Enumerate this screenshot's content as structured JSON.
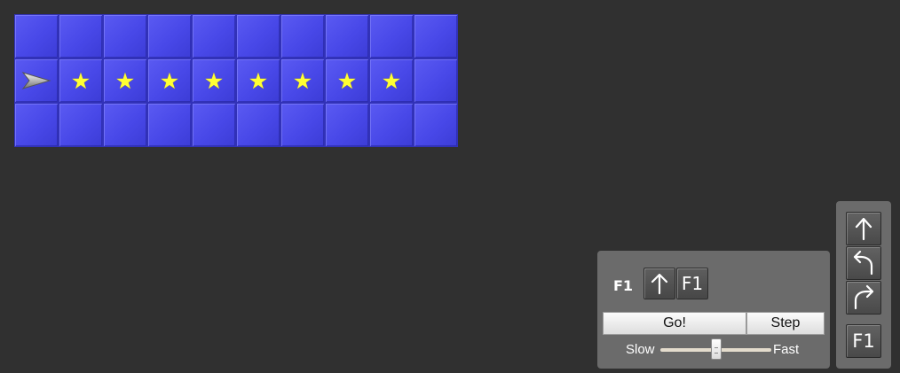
{
  "board": {
    "rows": 3,
    "cols": 10,
    "robot": {
      "row": 1,
      "col": 0,
      "facing": "right"
    },
    "stars": [
      {
        "row": 1,
        "col": 1
      },
      {
        "row": 1,
        "col": 2
      },
      {
        "row": 1,
        "col": 3
      },
      {
        "row": 1,
        "col": 4
      },
      {
        "row": 1,
        "col": 5
      },
      {
        "row": 1,
        "col": 6
      },
      {
        "row": 1,
        "col": 7
      },
      {
        "row": 1,
        "col": 8
      }
    ],
    "star_glyph": "★",
    "colors": {
      "tile": "#4848e8",
      "star": "#ffff33"
    }
  },
  "program": {
    "function_label": "F1",
    "slots": [
      {
        "type": "forward",
        "icon": "up-arrow-icon"
      },
      {
        "type": "call",
        "label": "F1"
      }
    ],
    "go_label": "Go!",
    "step_label": "Step",
    "speed": {
      "slow_label": "Slow",
      "fast_label": "Fast",
      "value": 0.5
    }
  },
  "palette": {
    "items": [
      {
        "type": "forward",
        "icon": "up-arrow-icon"
      },
      {
        "type": "turn-left",
        "icon": "turn-left-icon"
      },
      {
        "type": "turn-right",
        "icon": "turn-right-icon"
      },
      {
        "type": "call",
        "label": "F1"
      }
    ]
  }
}
